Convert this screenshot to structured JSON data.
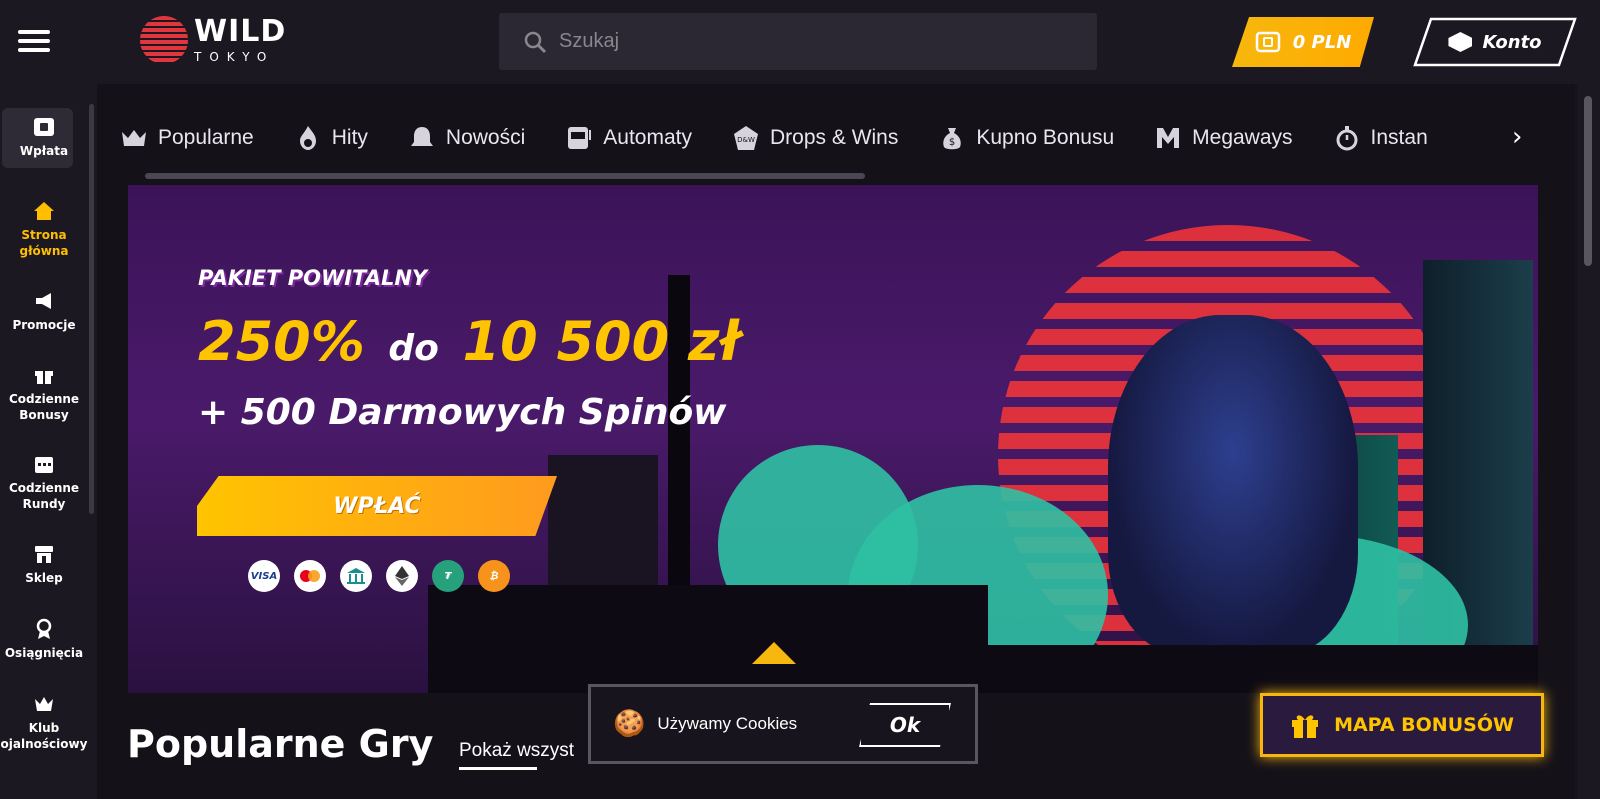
{
  "header": {
    "logo_main": "WILD",
    "logo_sub": "TOKYO",
    "search_placeholder": "Szukaj",
    "balance_label": "0 PLN",
    "account_label": "Konto"
  },
  "sidebar": {
    "items": [
      {
        "label": "Wpłata",
        "icon": "wallet-icon"
      },
      {
        "label": "Strona główna",
        "icon": "home-icon"
      },
      {
        "label": "Promocje",
        "icon": "megaphone-icon"
      },
      {
        "label": "Codzienne Bonusy",
        "icon": "gift-icon"
      },
      {
        "label": "Codzienne Rundy",
        "icon": "calendar-icon"
      },
      {
        "label": "Sklep",
        "icon": "shop-icon"
      },
      {
        "label": "Osiągnięcia",
        "icon": "medal-icon"
      },
      {
        "label": "Klub ojalnościowy",
        "icon": "crown-icon"
      }
    ],
    "active_index": 1
  },
  "categories": [
    {
      "label": "Popularne",
      "icon": "crown-icon"
    },
    {
      "label": "Hity",
      "icon": "flame-icon"
    },
    {
      "label": "Nowości",
      "icon": "bell-icon"
    },
    {
      "label": "Automaty",
      "icon": "slot-machine-icon"
    },
    {
      "label": "Drops & Wins",
      "icon": "drops-wins-icon"
    },
    {
      "label": "Kupno Bonusu",
      "icon": "money-bag-icon"
    },
    {
      "label": "Megaways",
      "icon": "megaways-icon"
    },
    {
      "label": "Instan",
      "icon": "stopwatch-icon"
    }
  ],
  "banner": {
    "kicker": "PAKIET POWITALNY",
    "amount_pct": "250%",
    "amount_mid": "do",
    "amount_max": "10 500 zł",
    "subtitle": "+ 500 Darmowych Spinów",
    "cta": "WPŁAĆ",
    "payments": [
      "VISA",
      "mastercard-icon",
      "bank-icon",
      "ethereum-icon",
      "tether-icon",
      "bitcoin-icon"
    ]
  },
  "section": {
    "title": "Popularne Gry",
    "show_all": "Pokaż wszyst"
  },
  "cookie": {
    "text": "Używamy Cookies",
    "ok": "Ok"
  },
  "bonus_map": {
    "label": "MAPA BONUSÓW"
  },
  "colors": {
    "accent": "#ffc400",
    "background": "#17141d",
    "sun": "#e5323b"
  }
}
